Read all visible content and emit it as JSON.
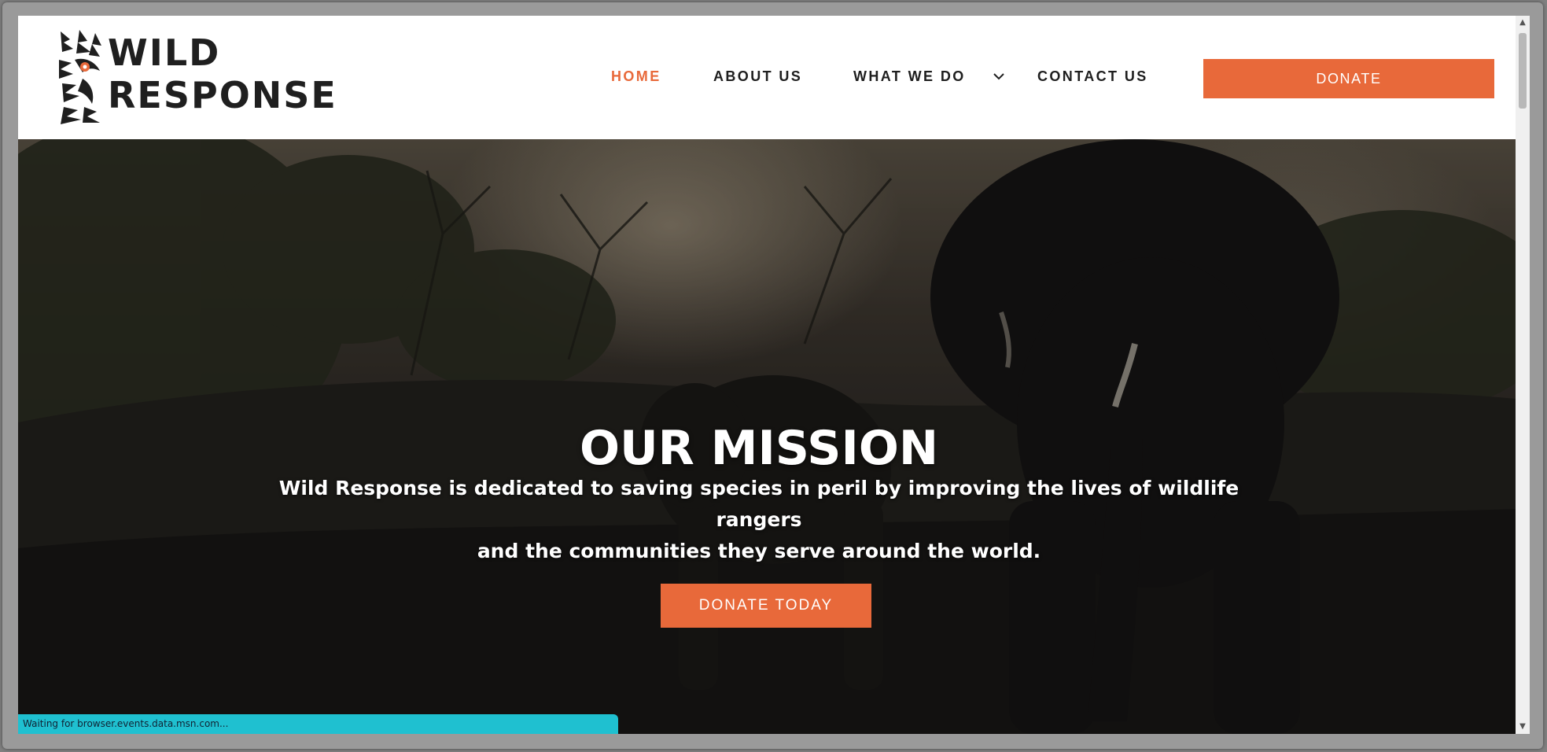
{
  "brand": {
    "line1": "WILD",
    "line2": "RESPONSE",
    "accent_color": "#e8693a"
  },
  "nav": {
    "items": [
      {
        "label": "HOME",
        "active": true
      },
      {
        "label": "ABOUT US",
        "active": false
      },
      {
        "label": "WHAT WE DO",
        "active": false,
        "has_dropdown": true
      },
      {
        "label": "CONTACT US",
        "active": false
      }
    ],
    "donate_label": "DONATE"
  },
  "hero": {
    "title": "OUR MISSION",
    "text_line1": "Wild Response is dedicated to saving species in peril by improving the lives of wildlife rangers",
    "text_line2": "and the communities they serve around the world.",
    "cta_label": "DONATE TODAY"
  },
  "status_bar": {
    "text": "Waiting for browser.events.data.msn.com..."
  },
  "icons": [
    "logo-mark-icon",
    "chevron-down-icon",
    "scroll-up-icon",
    "scroll-down-icon"
  ]
}
